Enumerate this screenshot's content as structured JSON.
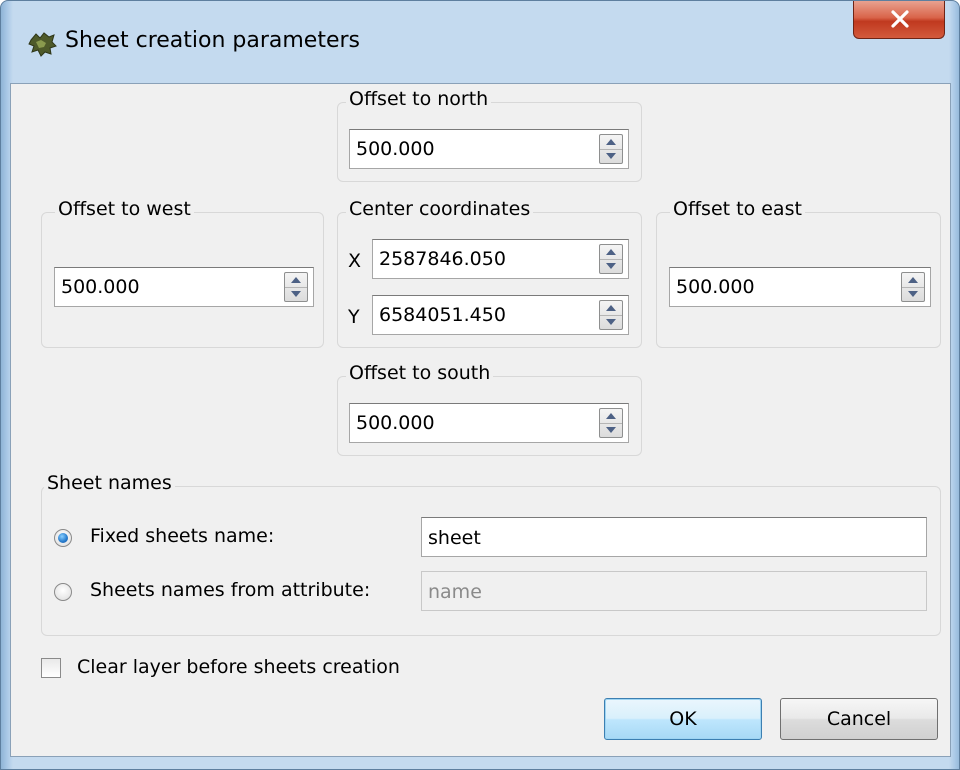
{
  "window": {
    "title": "Sheet creation parameters",
    "close_label": "X"
  },
  "offsets": {
    "north": {
      "label": "Offset to north",
      "value": "500.000"
    },
    "west": {
      "label": "Offset to west",
      "value": "500.000"
    },
    "east": {
      "label": "Offset to east",
      "value": "500.000"
    },
    "south": {
      "label": "Offset to south",
      "value": "500.000"
    }
  },
  "center": {
    "label": "Center coordinates",
    "x_label": "X",
    "x_value": "2587846.050",
    "y_label": "Y",
    "y_value": "6584051.450"
  },
  "sheet_names": {
    "label": "Sheet names",
    "fixed_label": "Fixed sheets name:",
    "fixed_value": "sheet",
    "fixed_selected": true,
    "attribute_label": "Sheets names from attribute:",
    "attribute_value": "name",
    "attribute_selected": false
  },
  "clear_layer": {
    "label": "Clear layer before sheets creation",
    "checked": false
  },
  "buttons": {
    "ok": "OK",
    "cancel": "Cancel"
  },
  "colors": {
    "frame": "#c4daef",
    "client": "#f0f0f0",
    "close": "#c7432a",
    "default_button": "#bee6fd"
  }
}
